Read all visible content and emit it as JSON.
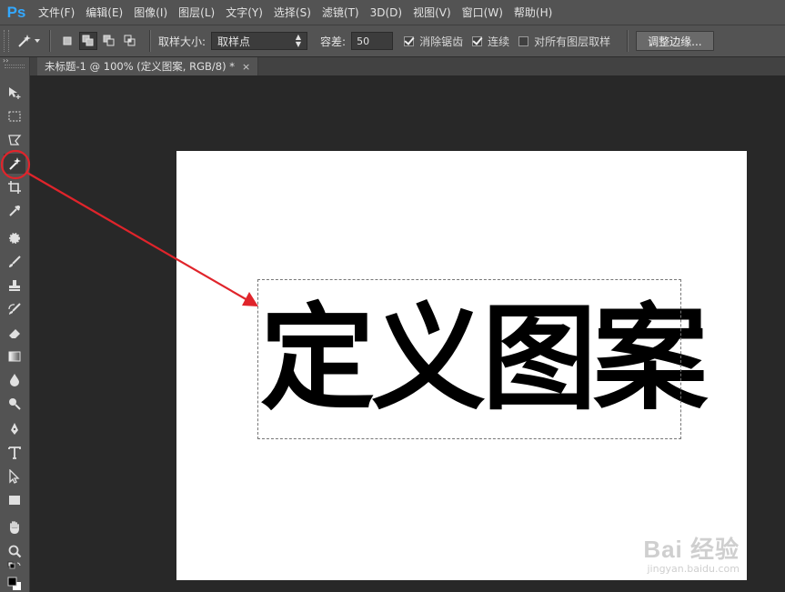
{
  "app": {
    "logo": "Ps"
  },
  "menu": [
    "文件(F)",
    "编辑(E)",
    "图像(I)",
    "图层(L)",
    "文字(Y)",
    "选择(S)",
    "滤镜(T)",
    "3D(D)",
    "视图(V)",
    "窗口(W)",
    "帮助(H)"
  ],
  "options": {
    "sample_size_label": "取样大小:",
    "sample_size_value": "取样点",
    "tolerance_label": "容差:",
    "tolerance_value": "50",
    "antialias_label": "消除锯齿",
    "contiguous_label": "连续",
    "sample_all_label": "对所有图层取样",
    "refine_edge_label": "调整边缘..."
  },
  "document": {
    "tab_title": "未标题-1 @ 100% (定义图案, RGB/8) *",
    "close_glyph": "×",
    "artwork_text": "定义图案"
  },
  "watermark": {
    "main": "Bai 经验",
    "sub": "jingyan.baidu.com"
  },
  "colors": {
    "annotation": "#e0242b",
    "menu_bg": "#535353",
    "workspace": "#282828"
  }
}
